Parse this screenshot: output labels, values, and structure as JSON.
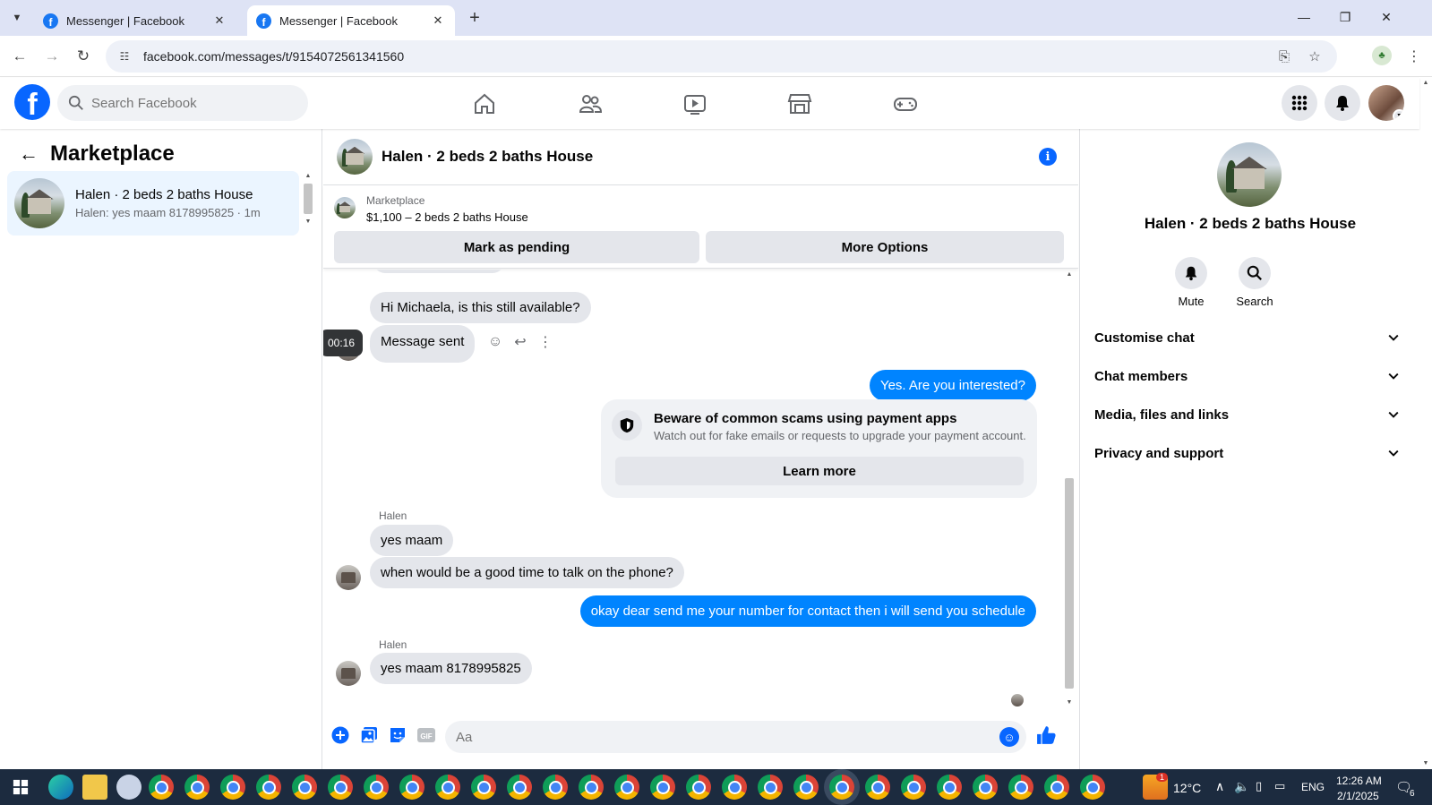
{
  "browser": {
    "tabs": [
      {
        "title": "Messenger | Facebook",
        "active": false
      },
      {
        "title": "Messenger | Facebook",
        "active": true
      }
    ],
    "url": "facebook.com/messages/t/9154072561341560"
  },
  "fb_header": {
    "search_placeholder": "Search Facebook"
  },
  "left_panel": {
    "title": "Marketplace",
    "conversations": [
      {
        "name": "Halen · 2 beds 2 baths House",
        "preview": "Halen: yes maam 8178995825 · 1m"
      }
    ]
  },
  "chat": {
    "title": "Halen · 2 beds 2 baths House",
    "listing": {
      "label": "Marketplace",
      "price_title": "$1,100 – 2 beds 2 baths House",
      "mark_pending_label": "Mark as pending",
      "more_options_label": "More Options"
    },
    "messages": {
      "m1": "Hi Michaela, is this still available?",
      "m2": "Message sent",
      "m2_time": "00:16",
      "m3": "Yes. Are you interested?",
      "scam_title": "Beware of common scams using payment apps",
      "scam_subtitle": "Watch out for fake emails or requests to upgrade your payment account.",
      "scam_button": "Learn more",
      "sender1": "Halen",
      "m4": "yes maam",
      "m5": "when would be a good time to talk on the phone?",
      "m6": "okay dear send me your number for contact then i will send  you schedule",
      "sender2": "Halen",
      "m7": "yes maam 8178995825"
    },
    "composer": {
      "placeholder": "Aa"
    }
  },
  "right_panel": {
    "name": "Halen · 2 beds 2 baths House",
    "mute_label": "Mute",
    "search_label": "Search",
    "sections": [
      "Customise chat",
      "Chat members",
      "Media, files and links",
      "Privacy and support"
    ]
  },
  "taskbar": {
    "temperature": "12°C",
    "weather_badge": "1",
    "language": "ENG",
    "time": "12:26 AM",
    "date": "2/1/2025",
    "notification_count": "6"
  },
  "colors": {
    "fb_blue": "#0866ff",
    "messenger_blue": "#0084ff",
    "bubble_grey": "#e4e6eb",
    "active_conversation": "#ebf5ff"
  }
}
